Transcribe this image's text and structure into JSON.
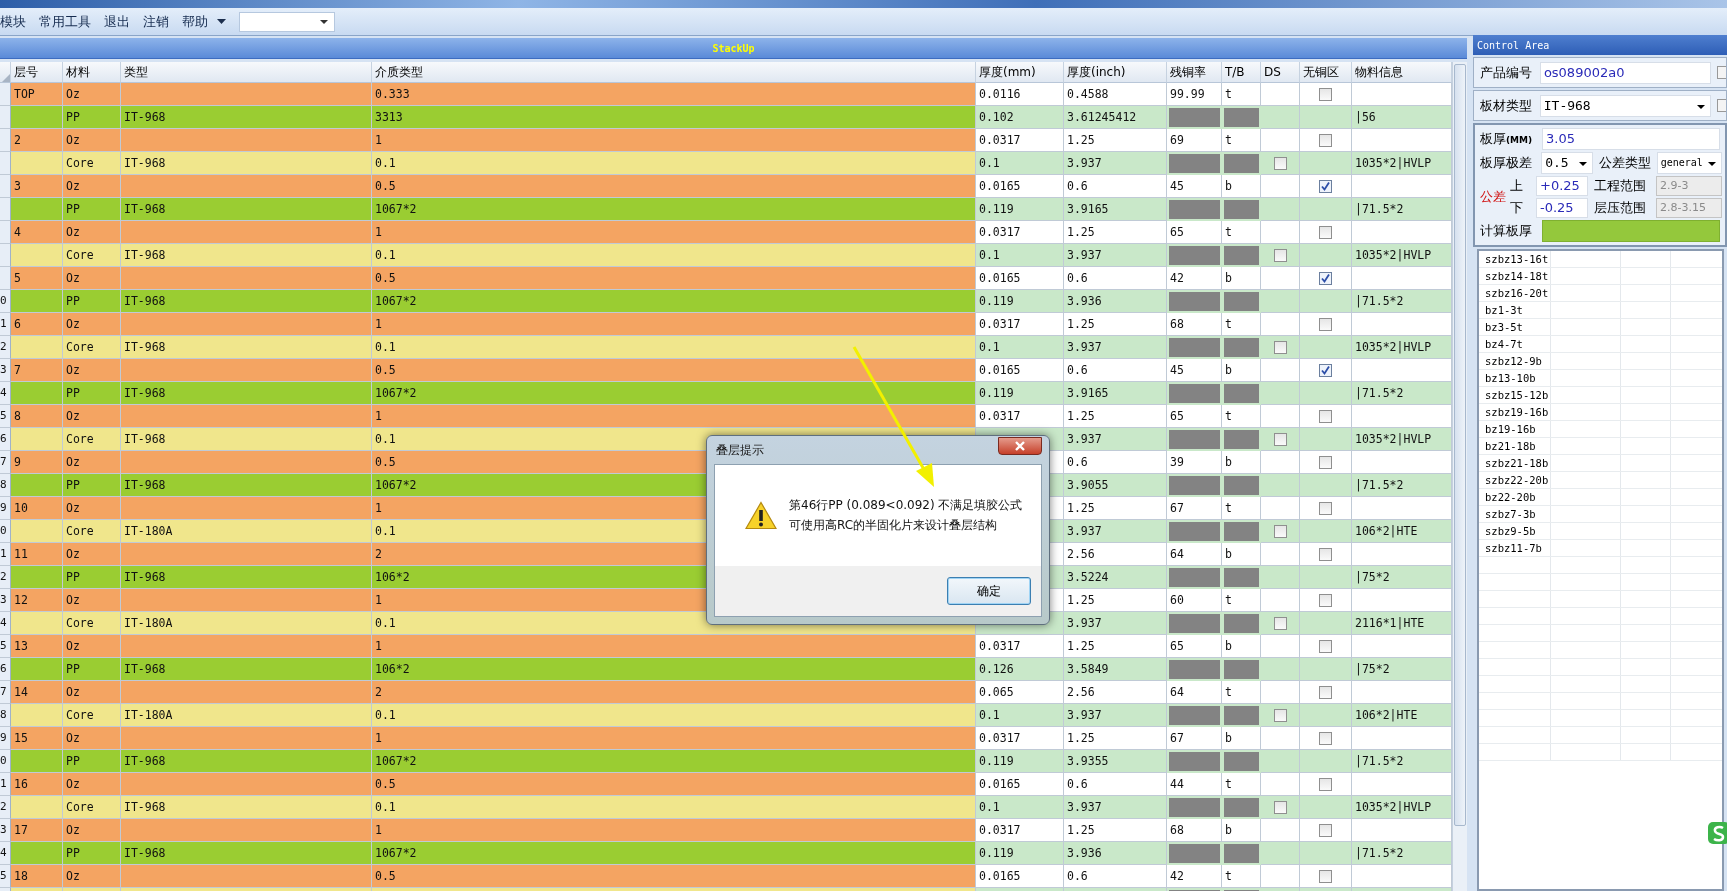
{
  "menu": [
    "模块",
    "常用工具",
    "退出",
    "注销",
    "帮助"
  ],
  "stackup": {
    "title": "StackUp"
  },
  "table": {
    "columns": [
      "层号",
      "材料",
      "类型",
      "介质类型",
      "厚度(mm)",
      "厚度(inch)",
      "残铜率",
      "T/B",
      "DS",
      "无铜区",
      "物料信息"
    ],
    "rows": [
      {
        "kind": "copper",
        "layer": "TOP",
        "material": "Oz",
        "dielectric": "0.333",
        "mm": "0.0116",
        "inch": "0.4588",
        "copper_rate": "99.99",
        "tb": "t",
        "no_copper": false
      },
      {
        "kind": "pp",
        "material": "PP",
        "type": "IT-968",
        "dielectric": "3313",
        "mm": "0.102",
        "inch": "3.61245412",
        "info": "|56"
      },
      {
        "kind": "copper",
        "layer": "2",
        "material": "Oz",
        "dielectric": "1",
        "mm": "0.0317",
        "inch": "1.25",
        "copper_rate": "69",
        "tb": "t",
        "no_copper": false
      },
      {
        "kind": "core",
        "material": "Core",
        "type": "IT-968",
        "dielectric": "0.1",
        "mm": "0.1",
        "inch": "3.937",
        "ds": false,
        "info": "1035*2|HVLP"
      },
      {
        "kind": "copper",
        "layer": "3",
        "material": "Oz",
        "dielectric": "0.5",
        "mm": "0.0165",
        "inch": "0.6",
        "copper_rate": "45",
        "tb": "b",
        "no_copper": true
      },
      {
        "kind": "pp",
        "material": "PP",
        "type": "IT-968",
        "dielectric": "1067*2",
        "mm": "0.119",
        "inch": "3.9165",
        "info": "|71.5*2"
      },
      {
        "kind": "copper",
        "layer": "4",
        "material": "Oz",
        "dielectric": "1",
        "mm": "0.0317",
        "inch": "1.25",
        "copper_rate": "65",
        "tb": "t",
        "no_copper": false
      },
      {
        "kind": "core",
        "material": "Core",
        "type": "IT-968",
        "dielectric": "0.1",
        "mm": "0.1",
        "inch": "3.937",
        "ds": false,
        "info": "1035*2|HVLP"
      },
      {
        "kind": "copper",
        "layer": "5",
        "material": "Oz",
        "dielectric": "0.5",
        "mm": "0.0165",
        "inch": "0.6",
        "copper_rate": "42",
        "tb": "b",
        "no_copper": true
      },
      {
        "kind": "pp",
        "row_marker": "0",
        "material": "PP",
        "type": "IT-968",
        "dielectric": "1067*2",
        "mm": "0.119",
        "inch": "3.936",
        "info": "|71.5*2"
      },
      {
        "kind": "copper",
        "row_marker": "1",
        "layer": "6",
        "material": "Oz",
        "dielectric": "1",
        "mm": "0.0317",
        "inch": "1.25",
        "copper_rate": "68",
        "tb": "t",
        "no_copper": false
      },
      {
        "kind": "core",
        "row_marker": "2",
        "material": "Core",
        "type": "IT-968",
        "dielectric": "0.1",
        "mm": "0.1",
        "inch": "3.937",
        "ds": false,
        "info": "1035*2|HVLP"
      },
      {
        "kind": "copper",
        "row_marker": "3",
        "layer": "7",
        "material": "Oz",
        "dielectric": "0.5",
        "mm": "0.0165",
        "inch": "0.6",
        "copper_rate": "45",
        "tb": "b",
        "no_copper": true
      },
      {
        "kind": "pp",
        "row_marker": "4",
        "material": "PP",
        "type": "IT-968",
        "dielectric": "1067*2",
        "mm": "0.119",
        "inch": "3.9165",
        "info": "|71.5*2"
      },
      {
        "kind": "copper",
        "row_marker": "5",
        "layer": "8",
        "material": "Oz",
        "dielectric": "1",
        "mm": "0.0317",
        "inch": "1.25",
        "copper_rate": "65",
        "tb": "t",
        "no_copper": false
      },
      {
        "kind": "core",
        "row_marker": "6",
        "material": "Core",
        "type": "IT-968",
        "dielectric": "0.1",
        "inch": "3.937",
        "ds": false,
        "info": "1035*2|HVLP"
      },
      {
        "kind": "copper",
        "row_marker": "7",
        "layer": "9",
        "material": "Oz",
        "dielectric": "0.5",
        "inch": "0.6",
        "copper_rate": "39",
        "tb": "b",
        "no_copper": false
      },
      {
        "kind": "pp",
        "row_marker": "8",
        "material": "PP",
        "type": "IT-968",
        "dielectric": "1067*2",
        "inch": "3.9055",
        "info": "|71.5*2"
      },
      {
        "kind": "copper",
        "row_marker": "9",
        "layer": "10",
        "material": "Oz",
        "dielectric": "1",
        "inch": "1.25",
        "copper_rate": "67",
        "tb": "t",
        "no_copper": false
      },
      {
        "kind": "core",
        "row_marker": "0",
        "material": "Core",
        "type": "IT-180A",
        "dielectric": "0.1",
        "inch": "3.937",
        "ds": false,
        "info": "106*2|HTE"
      },
      {
        "kind": "copper",
        "row_marker": "1",
        "layer": "11",
        "material": "Oz",
        "dielectric": "2",
        "inch": "2.56",
        "copper_rate": "64",
        "tb": "b",
        "no_copper": false
      },
      {
        "kind": "pp",
        "row_marker": "2",
        "material": "PP",
        "type": "IT-968",
        "dielectric": "106*2",
        "inch": "3.5224",
        "info": "|75*2"
      },
      {
        "kind": "copper",
        "row_marker": "3",
        "layer": "12",
        "material": "Oz",
        "dielectric": "1",
        "inch": "1.25",
        "copper_rate": "60",
        "tb": "t",
        "no_copper": false
      },
      {
        "kind": "core",
        "row_marker": "4",
        "material": "Core",
        "type": "IT-180A",
        "dielectric": "0.1",
        "inch": "3.937",
        "ds": false,
        "info": "2116*1|HTE"
      },
      {
        "kind": "copper",
        "row_marker": "5",
        "layer": "13",
        "material": "Oz",
        "dielectric": "1",
        "mm": "0.0317",
        "inch": "1.25",
        "copper_rate": "65",
        "tb": "b",
        "no_copper": false
      },
      {
        "kind": "pp",
        "row_marker": "6",
        "material": "PP",
        "type": "IT-968",
        "dielectric": "106*2",
        "mm": "0.126",
        "inch": "3.5849",
        "info": "|75*2"
      },
      {
        "kind": "copper",
        "row_marker": "7",
        "layer": "14",
        "material": "Oz",
        "dielectric": "2",
        "mm": "0.065",
        "inch": "2.56",
        "copper_rate": "64",
        "tb": "t",
        "no_copper": false
      },
      {
        "kind": "core",
        "row_marker": "8",
        "material": "Core",
        "type": "IT-180A",
        "dielectric": "0.1",
        "mm": "0.1",
        "inch": "3.937",
        "ds": false,
        "info": "106*2|HTE"
      },
      {
        "kind": "copper",
        "row_marker": "9",
        "layer": "15",
        "material": "Oz",
        "dielectric": "1",
        "mm": "0.0317",
        "inch": "1.25",
        "copper_rate": "67",
        "tb": "b",
        "no_copper": false
      },
      {
        "kind": "pp",
        "row_marker": "0",
        "material": "PP",
        "type": "IT-968",
        "dielectric": "1067*2",
        "mm": "0.119",
        "inch": "3.9355",
        "info": "|71.5*2"
      },
      {
        "kind": "copper",
        "row_marker": "1",
        "layer": "16",
        "material": "Oz",
        "dielectric": "0.5",
        "mm": "0.0165",
        "inch": "0.6",
        "copper_rate": "44",
        "tb": "t",
        "no_copper": false
      },
      {
        "kind": "core",
        "row_marker": "2",
        "material": "Core",
        "type": "IT-968",
        "dielectric": "0.1",
        "mm": "0.1",
        "inch": "3.937",
        "ds": false,
        "info": "1035*2|HVLP"
      },
      {
        "kind": "copper",
        "row_marker": "3",
        "layer": "17",
        "material": "Oz",
        "dielectric": "1",
        "mm": "0.0317",
        "inch": "1.25",
        "copper_rate": "68",
        "tb": "b",
        "no_copper": false
      },
      {
        "kind": "pp",
        "row_marker": "4",
        "material": "PP",
        "type": "IT-968",
        "dielectric": "1067*2",
        "mm": "0.119",
        "inch": "3.936",
        "info": "|71.5*2"
      },
      {
        "kind": "copper",
        "row_marker": "5",
        "layer": "18",
        "material": "Oz",
        "dielectric": "0.5",
        "mm": "0.0165",
        "inch": "0.6",
        "copper_rate": "42",
        "tb": "t",
        "no_copper": false
      },
      {
        "kind": "core"
      }
    ]
  },
  "control_area": {
    "title": "Control Area",
    "product_no": {
      "label": "产品编号",
      "value": "os089002a0",
      "checked": false
    },
    "board_material": {
      "label": "板材类型",
      "value": "IT-968",
      "checked": false
    },
    "thickness": {
      "label": "板厚",
      "unit": "(MM)",
      "value": "3.05"
    },
    "thickness_range": {
      "label": "板厚极差",
      "value": "0.5"
    },
    "tolerance_type": {
      "label": "公差类型",
      "value": "general"
    },
    "tolerance": {
      "label": "公差",
      "upper_label": "上",
      "upper": "+0.25",
      "lower_label": "下",
      "lower": "-0.25"
    },
    "eng_range": {
      "label": "工程范围",
      "value": "2.9-3",
      "disabled": true
    },
    "press_range": {
      "label": "层压范围",
      "value": "2.8-3.15",
      "disabled": true
    },
    "calc_thickness": {
      "label": "计算板厚"
    },
    "list": [
      "szbz13-16t",
      "szbz14-18t",
      "szbz16-20t",
      "bz1-3t",
      "bz3-5t",
      "bz4-7t",
      "szbz12-9b",
      "bz13-10b",
      "szbz15-12b",
      "szbz19-16b",
      "bz19-16b",
      "bz21-18b",
      "szbz21-18b",
      "szbz22-20b",
      "bz22-20b",
      "szbz7-3b",
      "szbz9-5b",
      "szbz11-7b"
    ]
  },
  "dialog": {
    "title": "叠层提示",
    "lines": [
      "第46行PP (0.089<0.092) 不满足填胶公式",
      "可使用高RC的半固化片来设计叠层结构"
    ],
    "ok": "确定"
  }
}
